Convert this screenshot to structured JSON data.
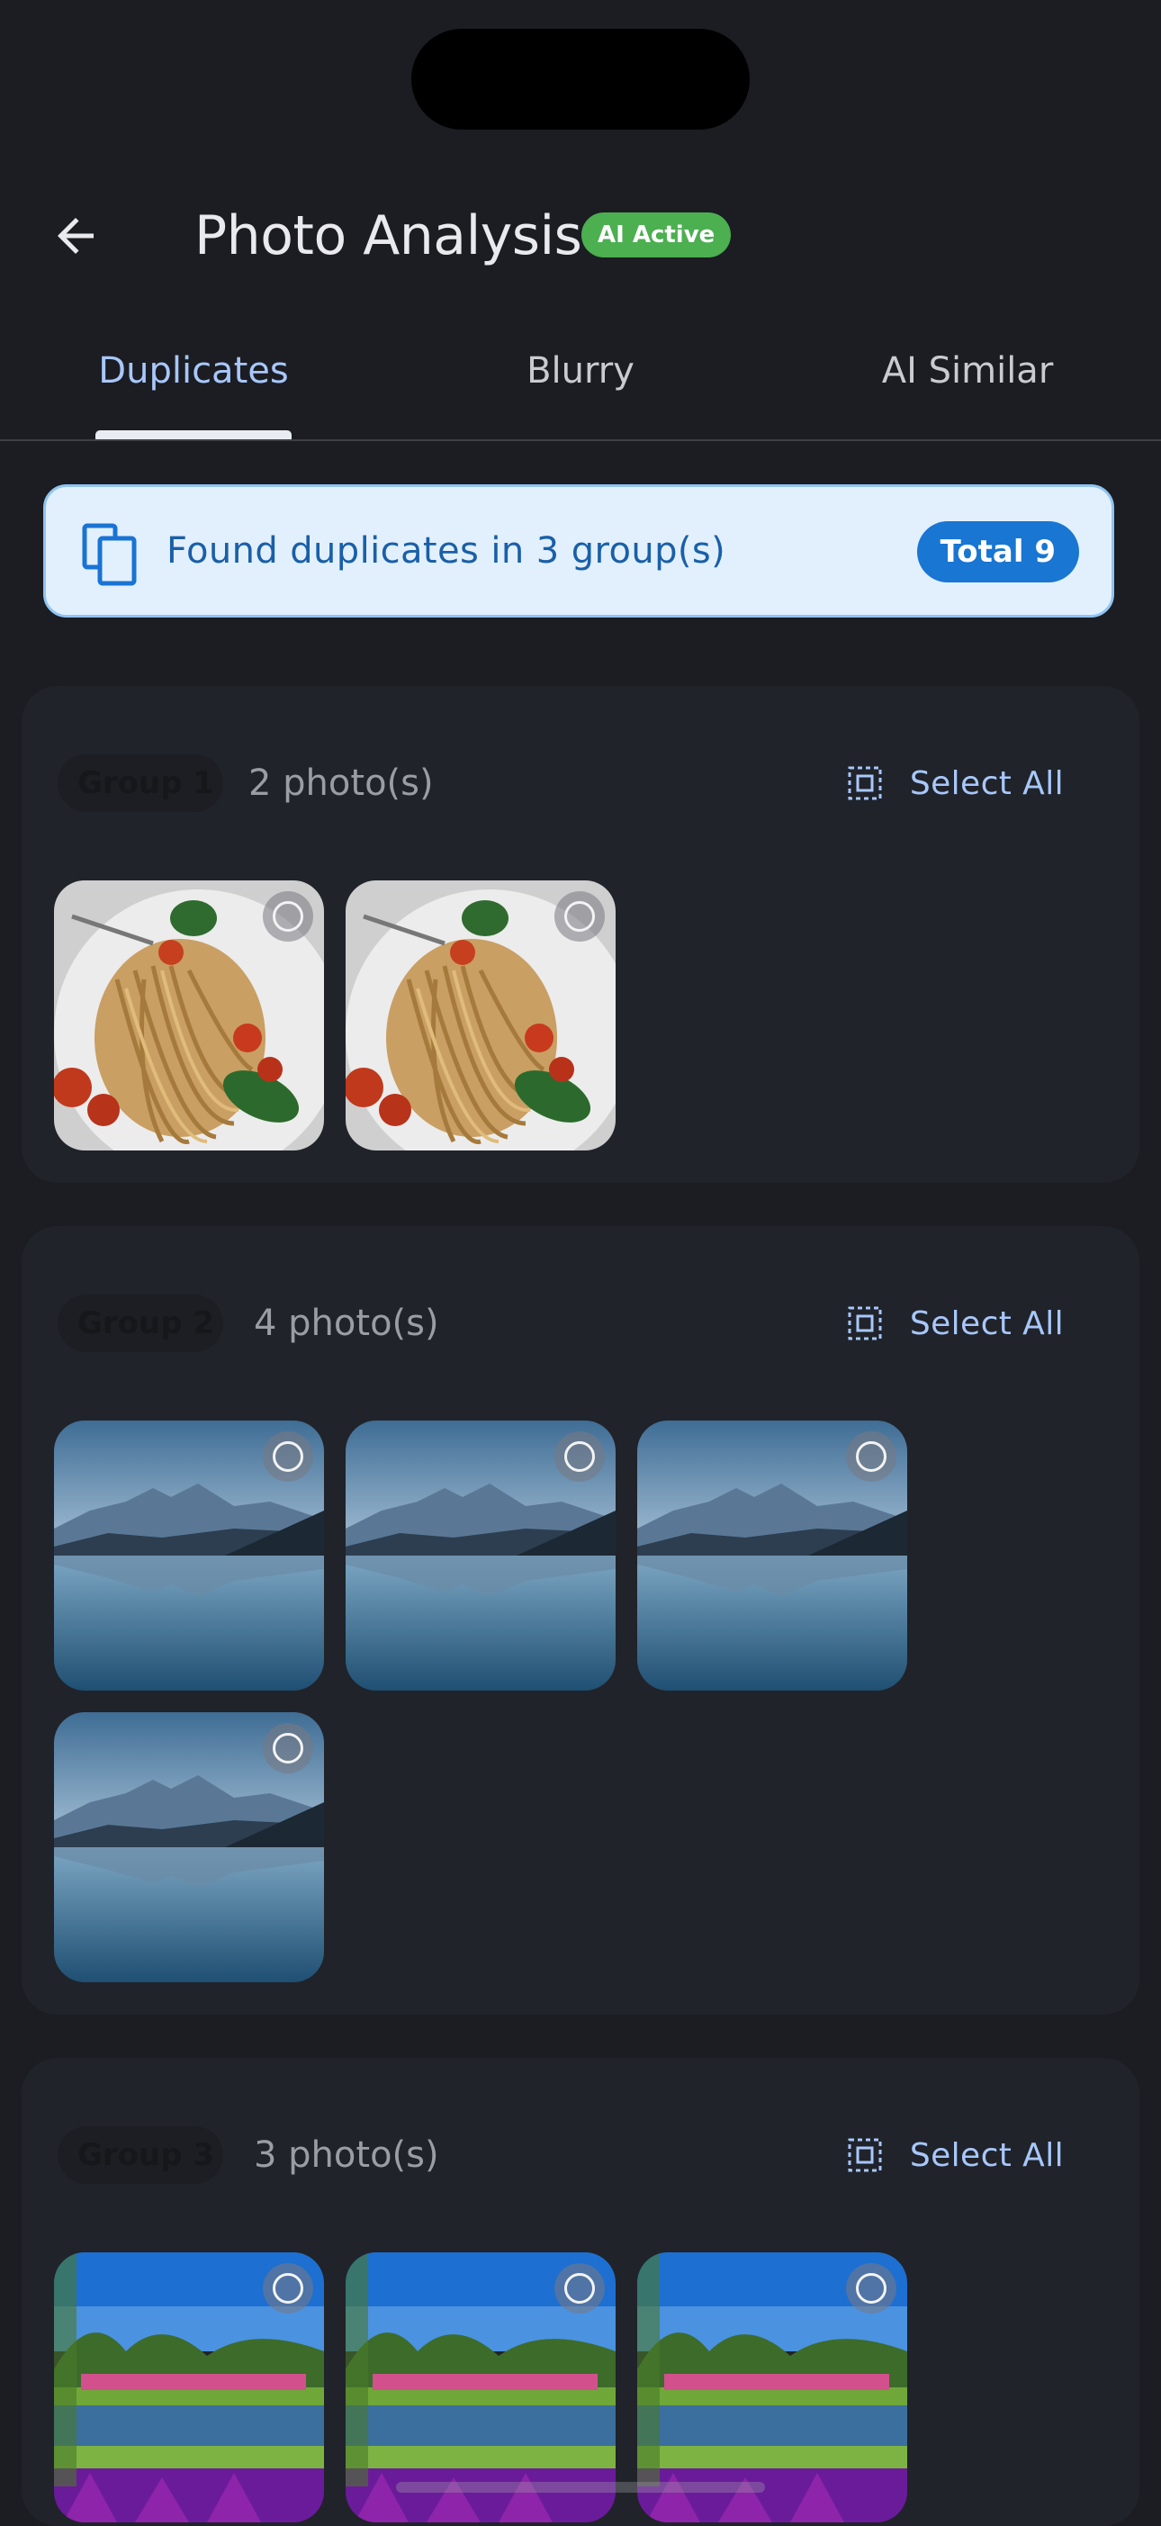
{
  "app": {
    "title": "Photo Analysis",
    "ai_badge": "AI Active"
  },
  "tabs": [
    {
      "label": "Duplicates",
      "active": true
    },
    {
      "label": "Blurry",
      "active": false
    },
    {
      "label": "AI Similar",
      "active": false
    }
  ],
  "banner": {
    "icon": "copy-icon",
    "text": "Found duplicates in 3 group(s)",
    "total_label": "Total 9"
  },
  "groups": [
    {
      "label": "Group 1",
      "count_label": "2 photo(s)",
      "select_all_label": "Select All",
      "photo_subject": "pasta"
    },
    {
      "label": "Group 2",
      "count_label": "4 photo(s)",
      "select_all_label": "Select All",
      "photo_subject": "mountain-lake"
    },
    {
      "label": "Group 3",
      "count_label": "3 photo(s)",
      "select_all_label": "Select All",
      "photo_subject": "garden-park"
    }
  ],
  "colors": {
    "background": "#1b1d22",
    "card": "#20232a",
    "accent": "#a8c7fa",
    "badge_green": "#4caf50",
    "banner_bg": "#e2f0fd",
    "banner_text": "#1a5fa8",
    "pill": "#1976d2"
  }
}
